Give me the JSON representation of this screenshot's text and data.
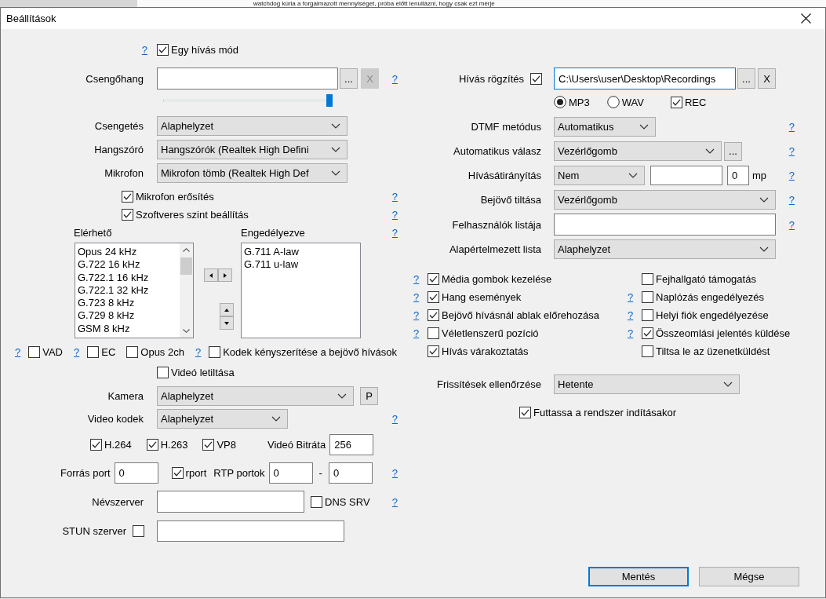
{
  "background": {
    "text": "watchdog kúria a forgalmazott mennyiséget, próba előtt lenullázni, hogy csak ezt mérje"
  },
  "window": {
    "title": "Beállítások"
  },
  "left": {
    "single_call": {
      "help": "?",
      "label": "Egy hívás mód",
      "checked": true
    },
    "ringtone": {
      "label": "Csengőhang",
      "browse": "...",
      "clear": {
        "label": "X",
        "disabled": true
      },
      "help": "?"
    },
    "ring_volume": {
      "level": 1
    },
    "devices": [
      {
        "label": "Csengetés",
        "value": "Alaphelyzet"
      },
      {
        "label": "Hangszóró",
        "value": "Hangszórók (Realtek High Defini"
      },
      {
        "label": "Mikrofon",
        "value": "Mikrofon tömb (Realtek High Def"
      }
    ],
    "mic_options": [
      {
        "label": "Mikrofon erősítés",
        "checked": true,
        "help": "?"
      },
      {
        "label": "Szoftveres szint beállítás",
        "checked": true,
        "help": "?"
      }
    ],
    "codecs": {
      "available_label": "Elérhető",
      "enabled_label": "Engedélyezve",
      "help": "?",
      "available": [
        "Opus 24 kHz",
        "G.722 16 kHz",
        "G.722.1 16 kHz",
        "G.722.1 32 kHz",
        "G.723 8 kHz",
        "G.729 8 kHz",
        "GSM 8 kHz"
      ],
      "enabled": [
        "G.711 A-law",
        "G.711 u-law"
      ]
    },
    "codec_options": [
      {
        "help": "?",
        "label": "VAD",
        "checked": false
      },
      {
        "help": "?",
        "label": "EC",
        "checked": false
      },
      {
        "label": "Opus 2ch",
        "checked": false
      },
      {
        "help": "?",
        "label": "Kodek kényszerítése a bejövő hívások",
        "checked": false
      }
    ],
    "disable_video": {
      "label": "Videó letiltása",
      "checked": false
    },
    "camera": {
      "label": "Kamera",
      "value": "Alaphelyzet",
      "button": "P"
    },
    "video_codec": {
      "label": "Video kodek",
      "value": "Alaphelyzet",
      "help": "?"
    },
    "video_formats": [
      {
        "label": "H.264",
        "checked": true
      },
      {
        "label": "H.263",
        "checked": true
      },
      {
        "label": "VP8",
        "checked": true
      }
    ],
    "video_bitrate": {
      "label": "Videó Bitráta",
      "value": "256"
    },
    "ports": {
      "source_label": "Forrás port",
      "source": "0",
      "rport": {
        "label": "rport",
        "checked": true
      },
      "rtp_label": "RTP portok",
      "rtp_from": "0",
      "separator": "-",
      "rtp_to": "0",
      "help": "?"
    },
    "nameserver": {
      "label": "Névszerver",
      "dns_srv": {
        "label": "DNS SRV",
        "checked": false
      },
      "help": "?"
    },
    "stun": {
      "label": "STUN szerver",
      "checked": false
    }
  },
  "right": {
    "recording": {
      "label": "Hívás rögzítés",
      "checked": true,
      "path": "C:\\Users\\user\\Desktop\\Recordings",
      "focused": true,
      "browse": "...",
      "clear": {
        "label": "X",
        "disabled": false
      }
    },
    "formats": [
      {
        "label": "MP3",
        "selected": true
      },
      {
        "label": "WAV",
        "selected": false
      }
    ],
    "rec": {
      "label": "REC",
      "checked": true
    },
    "dtmf": {
      "label": "DTMF metódus",
      "value": "Automatikus",
      "help": "?"
    },
    "auto_answer": {
      "label": "Automatikus válasz",
      "value": "Vezérlőgomb",
      "button": "...",
      "help": "?"
    },
    "forwarding": {
      "label": "Hívásátirányítás",
      "value": "Nem",
      "delay": "0",
      "unit": "mp",
      "help": "?"
    },
    "block_incoming": {
      "label": "Bejövő tiltása",
      "value": "Vezérlőgomb",
      "help": "?"
    },
    "user_list": {
      "label": "Felhasználók listája",
      "help": "?"
    },
    "default_list": {
      "label": "Alapértelmezett lista",
      "value": "Alaphelyzet"
    },
    "options": [
      {
        "help": "?",
        "label": "Média gombok kezelése",
        "checked": true
      },
      {
        "label": "Fejhallgató támogatás",
        "checked": false
      },
      {
        "help": "?",
        "label": "Hang események",
        "checked": true
      },
      {
        "help": "?",
        "label": "Naplózás engedélyezés",
        "checked": false
      },
      {
        "help": "?",
        "label": "Bejövő hívásnál ablak előrehozása",
        "checked": true
      },
      {
        "help": "?",
        "label": "Helyi fiók engedélyezése",
        "checked": false
      },
      {
        "help": "?",
        "label": "Véletlenszerű pozíció",
        "checked": false
      },
      {
        "help": "?",
        "label": "Összeomlási jelentés küldése",
        "checked": true
      },
      {
        "label": "Hívás várakoztatás",
        "checked": true
      },
      {
        "label": "Tiltsa le az üzenetküldést",
        "checked": false
      }
    ],
    "update_check": {
      "label": "Frissítések ellenőrzése",
      "value": "Hetente"
    },
    "autostart": {
      "label": "Futtassa a rendszer indításakor",
      "checked": true
    }
  },
  "buttons": [
    {
      "label": "Mentés",
      "default": true
    },
    {
      "label": "Mégse",
      "default": false
    }
  ]
}
